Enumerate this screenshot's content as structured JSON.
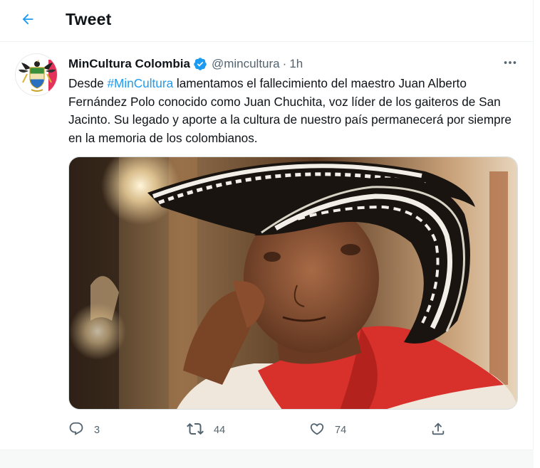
{
  "header": {
    "title": "Tweet",
    "back_icon": "arrow-left-icon",
    "accent": "#1d9bf0"
  },
  "tweet": {
    "display_name": "MinCultura Colombia",
    "verified_icon": "verified-badge-icon",
    "handle": "@mincultura",
    "separator": "·",
    "time": "1h",
    "text_before": "Desde ",
    "hashtag": "#MinCultura",
    "text_after": " lamentamos el fallecimiento del maestro Juan Alberto Fernández Polo conocido como Juan Chuchita, voz líder de los gaiteros de San Jacinto. Su legado y aporte a la cultura de nuestro país permanecerá por siempre en la memoria de los colombianos.",
    "media_icon": "photo-of-elderly-man-in-sombrero-vueltiao",
    "colors": {
      "text": "#0f1419",
      "secondary": "#536471",
      "link": "#1d9bf0"
    }
  },
  "actions": {
    "reply_count": "3",
    "retweet_count": "44",
    "like_count": "74"
  }
}
